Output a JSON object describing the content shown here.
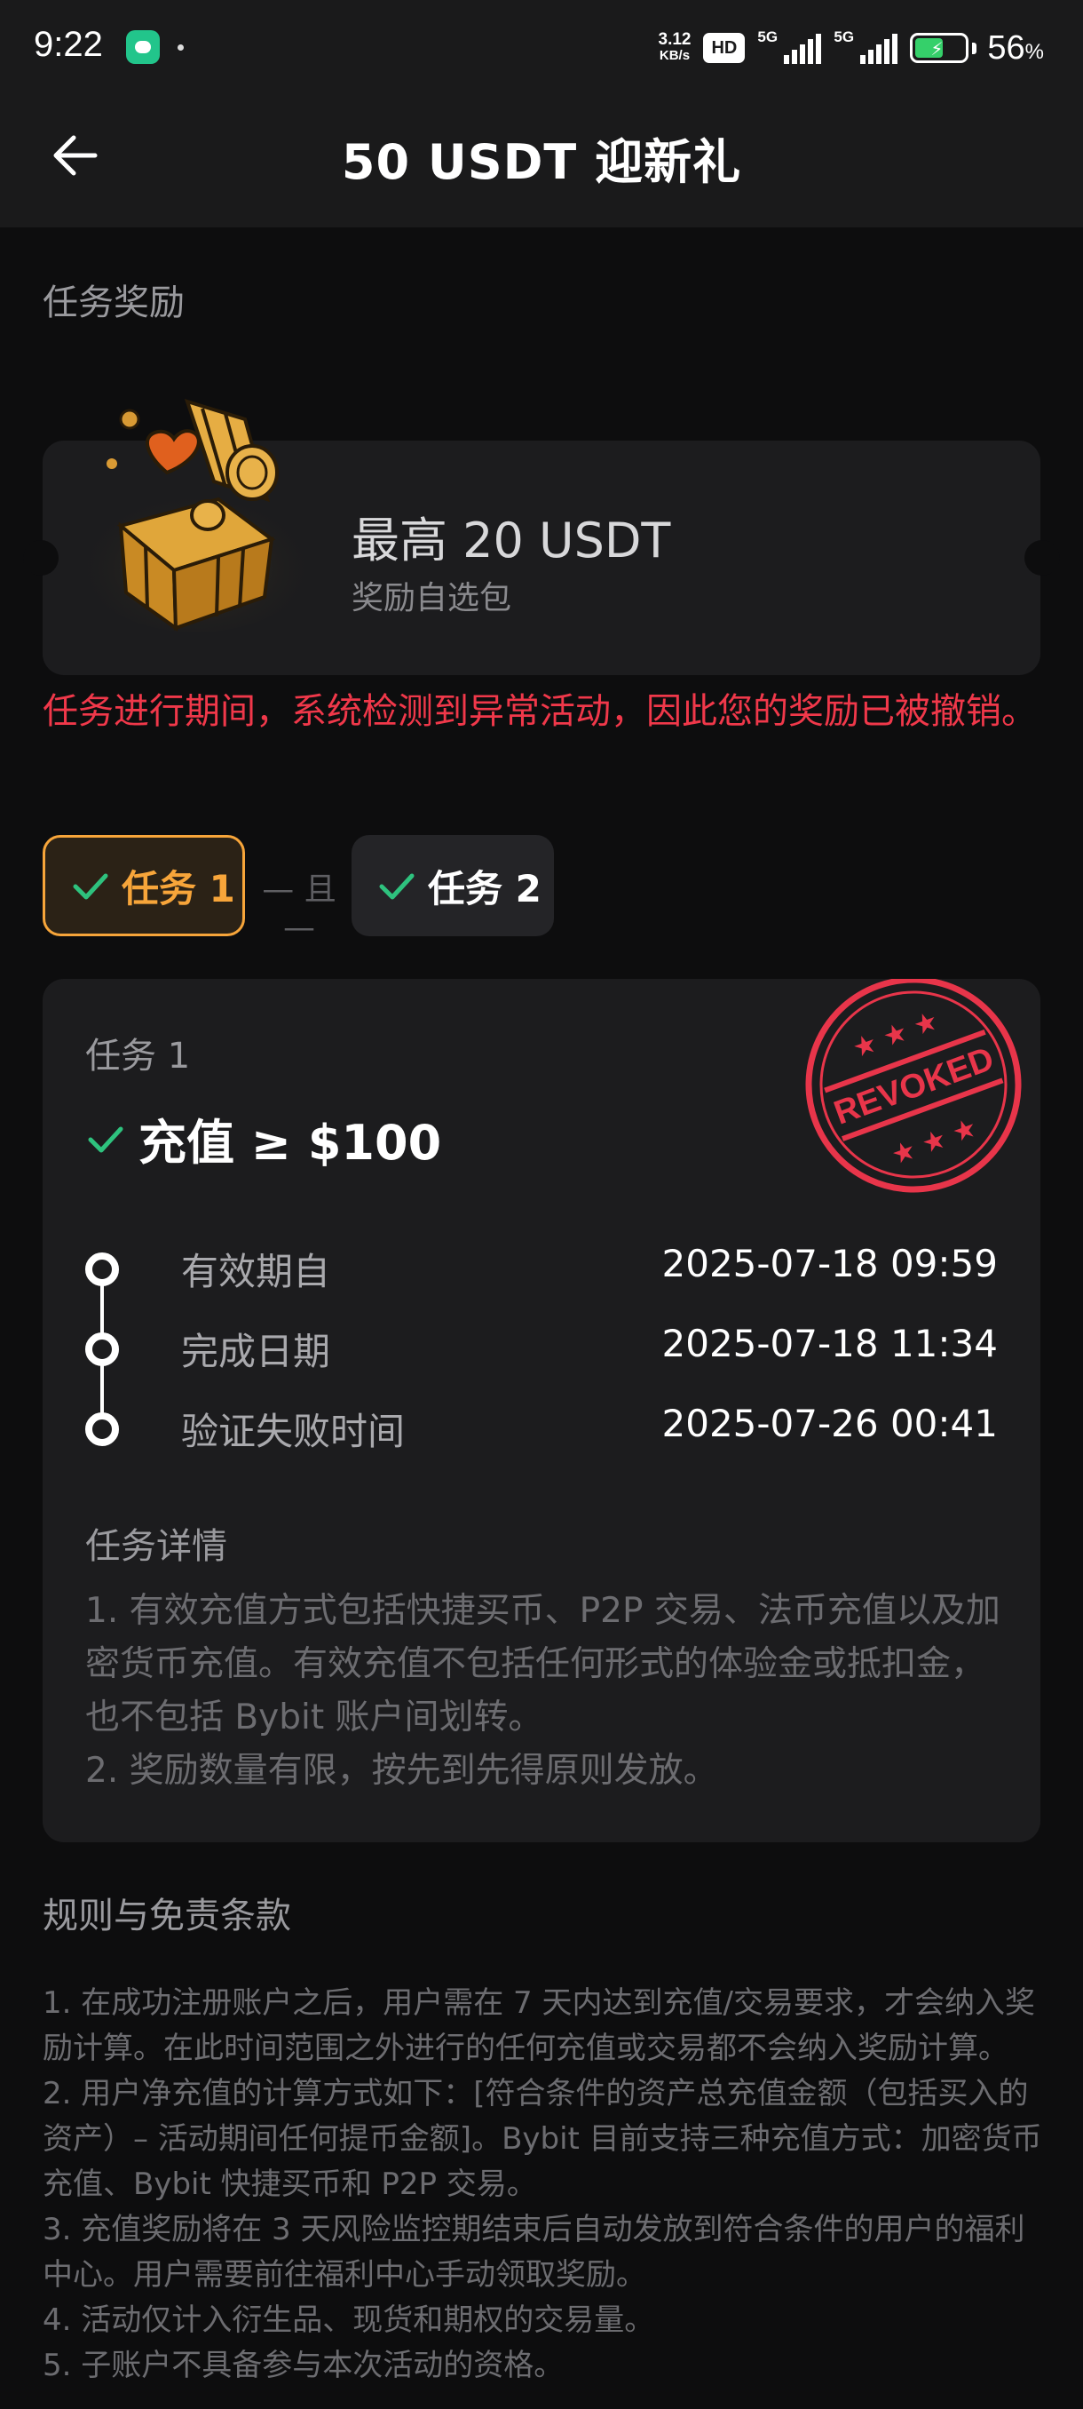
{
  "status_bar": {
    "time": "9:22",
    "net_speed_value": "3.12",
    "net_speed_unit": "KB/s",
    "hd_label": "HD",
    "signal_1_label": "5G",
    "signal_2_label": "5G",
    "battery_percent": "56",
    "battery_unit": "%",
    "battery_level": 0.56
  },
  "header": {
    "title": "50 USDT 迎新礼"
  },
  "reward_section": {
    "label": "任务奖励",
    "title": "最高 20 USDT",
    "subtitle": "奖励自选包"
  },
  "warning_text": "任务进行期间，系统检测到异常活动，因此您的奖励已被撤销。",
  "tabs": {
    "tab1_label": "任务 1",
    "tab2_label": "任务 2",
    "separator": "— 且 —"
  },
  "task": {
    "label": "任务 1",
    "requirement": "充值 ≥ $100",
    "stamp_text": "REVOKED",
    "timeline": [
      {
        "label": "有效期自",
        "value": "2025-07-18 09:59"
      },
      {
        "label": "完成日期",
        "value": "2025-07-18 11:34"
      },
      {
        "label": "验证失败时间",
        "value": "2025-07-26 00:41"
      }
    ],
    "detail_title": "任务详情",
    "detail_lines": [
      "1. 有效充值方式包括快捷买币、P2P 交易、法币充值以及加密货币充值。有效充值不包括任何形式的体验金或抵扣金，也不包括 Bybit 账户间划转。",
      "2. 奖励数量有限，按先到先得原则发放。"
    ]
  },
  "rules": {
    "title": "规则与免责条款",
    "lines": [
      "1. 在成功注册账户之后，用户需在 7 天内达到充值/交易要求，才会纳入奖励计算。在此时间范围之外进行的任何充值或交易都不会纳入奖励计算。",
      "2. 用户净充值的计算方式如下：[符合条件的资产总充值金额（包括买入的资产）– 活动期间任何提币金额]。Bybit 目前支持三种充值方式：加密货币充值、Bybit 快捷买币和 P2P 交易。",
      "3. 充值奖励将在 3 天风险监控期结束后自动发放到符合条件的用户的福利中心。用户需要前往福利中心手动领取奖励。",
      "4. 活动仅计入衍生品、现货和期权的交易量。",
      "5. 子账户不具备参与本次活动的资格。"
    ]
  },
  "colors": {
    "background": "#0d0d0e",
    "card": "#1c1c1e",
    "accent_orange": "#f7a53a",
    "check_green": "#2ec27e",
    "warning_red": "#f0384a"
  }
}
